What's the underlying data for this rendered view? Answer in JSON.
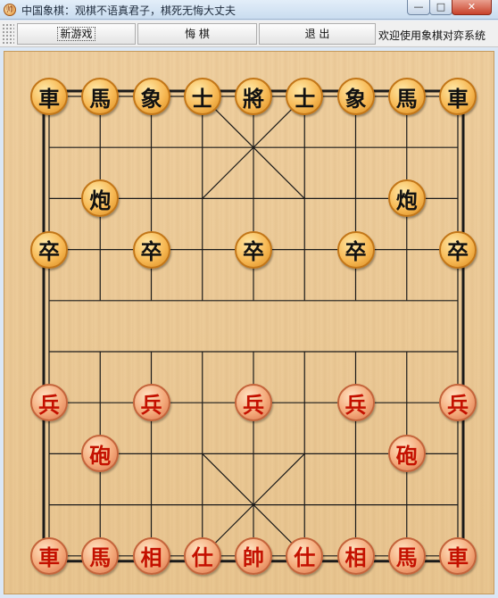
{
  "window": {
    "title": "中国象棋：观棋不语真君子，棋死无悔大丈夫",
    "icon": "xiangqi-app-icon",
    "minimize_label": "—",
    "maximize_label": "□",
    "close_label": "✕"
  },
  "toolbar": {
    "new_game_label": "新游戏",
    "undo_label": "悔 棋",
    "quit_label": "退 出",
    "status_text": "欢迎使用象棋对弈系统"
  },
  "board": {
    "files": 9,
    "ranks": 10,
    "line_color": "#1a1a1a",
    "black_color": "#111111",
    "red_color": "#c41000"
  },
  "pieces": [
    {
      "side": "black",
      "char": "車",
      "file": 0,
      "rank": 0
    },
    {
      "side": "black",
      "char": "馬",
      "file": 1,
      "rank": 0
    },
    {
      "side": "black",
      "char": "象",
      "file": 2,
      "rank": 0
    },
    {
      "side": "black",
      "char": "士",
      "file": 3,
      "rank": 0
    },
    {
      "side": "black",
      "char": "將",
      "file": 4,
      "rank": 0
    },
    {
      "side": "black",
      "char": "士",
      "file": 5,
      "rank": 0
    },
    {
      "side": "black",
      "char": "象",
      "file": 6,
      "rank": 0
    },
    {
      "side": "black",
      "char": "馬",
      "file": 7,
      "rank": 0
    },
    {
      "side": "black",
      "char": "車",
      "file": 8,
      "rank": 0
    },
    {
      "side": "black",
      "char": "炮",
      "file": 1,
      "rank": 2
    },
    {
      "side": "black",
      "char": "炮",
      "file": 7,
      "rank": 2
    },
    {
      "side": "black",
      "char": "卒",
      "file": 0,
      "rank": 3
    },
    {
      "side": "black",
      "char": "卒",
      "file": 2,
      "rank": 3
    },
    {
      "side": "black",
      "char": "卒",
      "file": 4,
      "rank": 3
    },
    {
      "side": "black",
      "char": "卒",
      "file": 6,
      "rank": 3
    },
    {
      "side": "black",
      "char": "卒",
      "file": 8,
      "rank": 3
    },
    {
      "side": "red",
      "char": "兵",
      "file": 0,
      "rank": 6
    },
    {
      "side": "red",
      "char": "兵",
      "file": 2,
      "rank": 6
    },
    {
      "side": "red",
      "char": "兵",
      "file": 4,
      "rank": 6
    },
    {
      "side": "red",
      "char": "兵",
      "file": 6,
      "rank": 6
    },
    {
      "side": "red",
      "char": "兵",
      "file": 8,
      "rank": 6
    },
    {
      "side": "red",
      "char": "砲",
      "file": 1,
      "rank": 7
    },
    {
      "side": "red",
      "char": "砲",
      "file": 7,
      "rank": 7
    },
    {
      "side": "red",
      "char": "車",
      "file": 0,
      "rank": 9
    },
    {
      "side": "red",
      "char": "馬",
      "file": 1,
      "rank": 9
    },
    {
      "side": "red",
      "char": "相",
      "file": 2,
      "rank": 9
    },
    {
      "side": "red",
      "char": "仕",
      "file": 3,
      "rank": 9
    },
    {
      "side": "red",
      "char": "帥",
      "file": 4,
      "rank": 9
    },
    {
      "side": "red",
      "char": "仕",
      "file": 5,
      "rank": 9
    },
    {
      "side": "red",
      "char": "相",
      "file": 6,
      "rank": 9
    },
    {
      "side": "red",
      "char": "馬",
      "file": 7,
      "rank": 9
    },
    {
      "side": "red",
      "char": "車",
      "file": 8,
      "rank": 9
    }
  ]
}
